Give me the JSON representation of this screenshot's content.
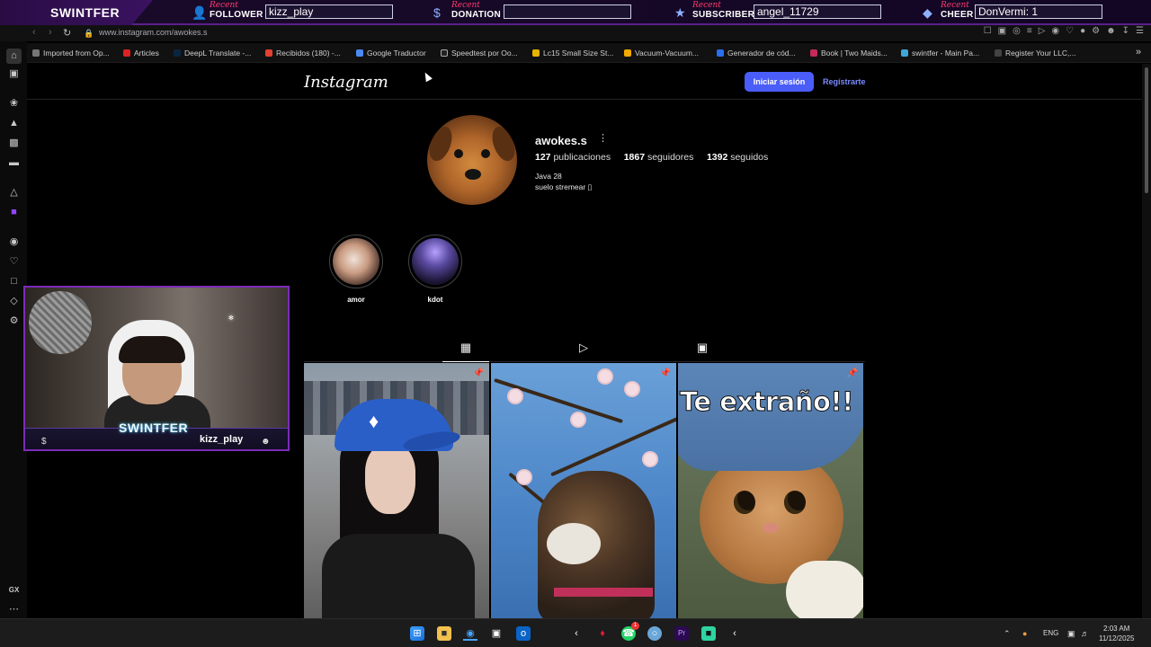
{
  "overlay": {
    "brand": "SWINTFER",
    "recent_label": "Recent",
    "slots": {
      "follower": {
        "kind": "FOLLOWER",
        "value": "kizz_play"
      },
      "donation": {
        "kind": "DONATION",
        "value": ""
      },
      "subscriber": {
        "kind": "SUBSCRIBER",
        "value": "angel_11729"
      },
      "cheer": {
        "kind": "CHEER",
        "value": "DonVermi: 1"
      }
    }
  },
  "browser": {
    "url": "www.instagram.com/awokes.s",
    "bookmarks": [
      "Imported from Op...",
      "Articles",
      "DeepL Translate -...",
      "Recibidos (180) -...",
      "Google Traductor",
      "Speedtest por Oo...",
      "Lc15 Small Size St...",
      "Vacuum-Vacuum...",
      "Generador de cód...",
      "Book | Two Maids...",
      "swintfer - Main Pa...",
      "Register Your LLC,..."
    ],
    "sidebar_footer": "GX"
  },
  "instagram": {
    "logo": "Instagram",
    "login_label": "Iniciar sesión",
    "register_label": "Regístrarte",
    "profile": {
      "username": "awokes.s",
      "posts_count": "127",
      "posts_label": "publicaciones",
      "followers_count": "1867",
      "followers_label": "seguidores",
      "following_count": "1392",
      "following_label": "seguidos",
      "bio_line1": "Java 28",
      "bio_line2": "suelo stremear ▯"
    },
    "highlights": [
      {
        "label": "amor"
      },
      {
        "label": "kdot"
      }
    ],
    "posts": [
      {
        "caption": ""
      },
      {
        "caption": ""
      },
      {
        "caption": "Te extraño!!"
      }
    ]
  },
  "webcam": {
    "streamer_name": "SWINTFER",
    "latest_viewer": "kizz_play"
  },
  "taskbar": {
    "language": "ENG",
    "time": "2:03 AM",
    "date": "11/12/2025",
    "whatsapp_badge": "1"
  }
}
